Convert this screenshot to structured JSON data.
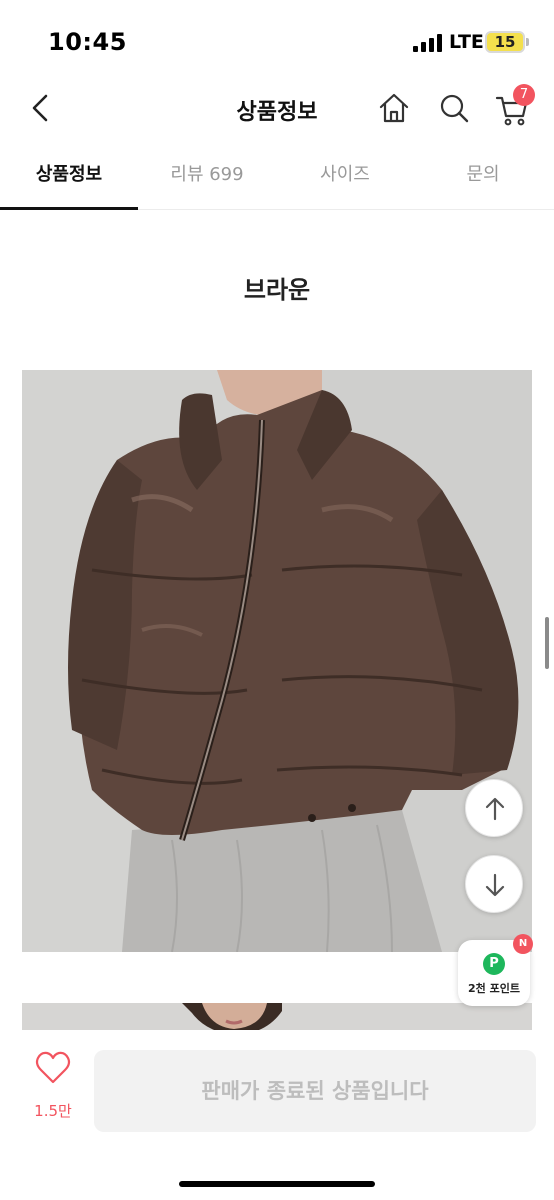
{
  "status_bar": {
    "time": "10:45",
    "network": "LTE",
    "battery": "15"
  },
  "header": {
    "title": "상품정보",
    "cart_count": "7",
    "icons": [
      "back-chevron-icon",
      "home-icon",
      "search-icon",
      "cart-icon"
    ]
  },
  "tabs": [
    {
      "label": "상품정보",
      "active": true
    },
    {
      "label": "리뷰 699",
      "active": false
    },
    {
      "label": "사이즈",
      "active": false
    },
    {
      "label": "문의",
      "active": false
    }
  ],
  "content": {
    "heading": "브라운"
  },
  "floating": {
    "points_label": "2천 포인트",
    "points_icon_letter": "P",
    "points_badge": "N"
  },
  "bottom_bar": {
    "like_count": "1.5만",
    "sold_out_label": "판매가 종료된 상품입니다"
  },
  "colors": {
    "accent": "#f2545f",
    "points_green": "#1eb75c",
    "jacket_brown": "#5e463d"
  }
}
